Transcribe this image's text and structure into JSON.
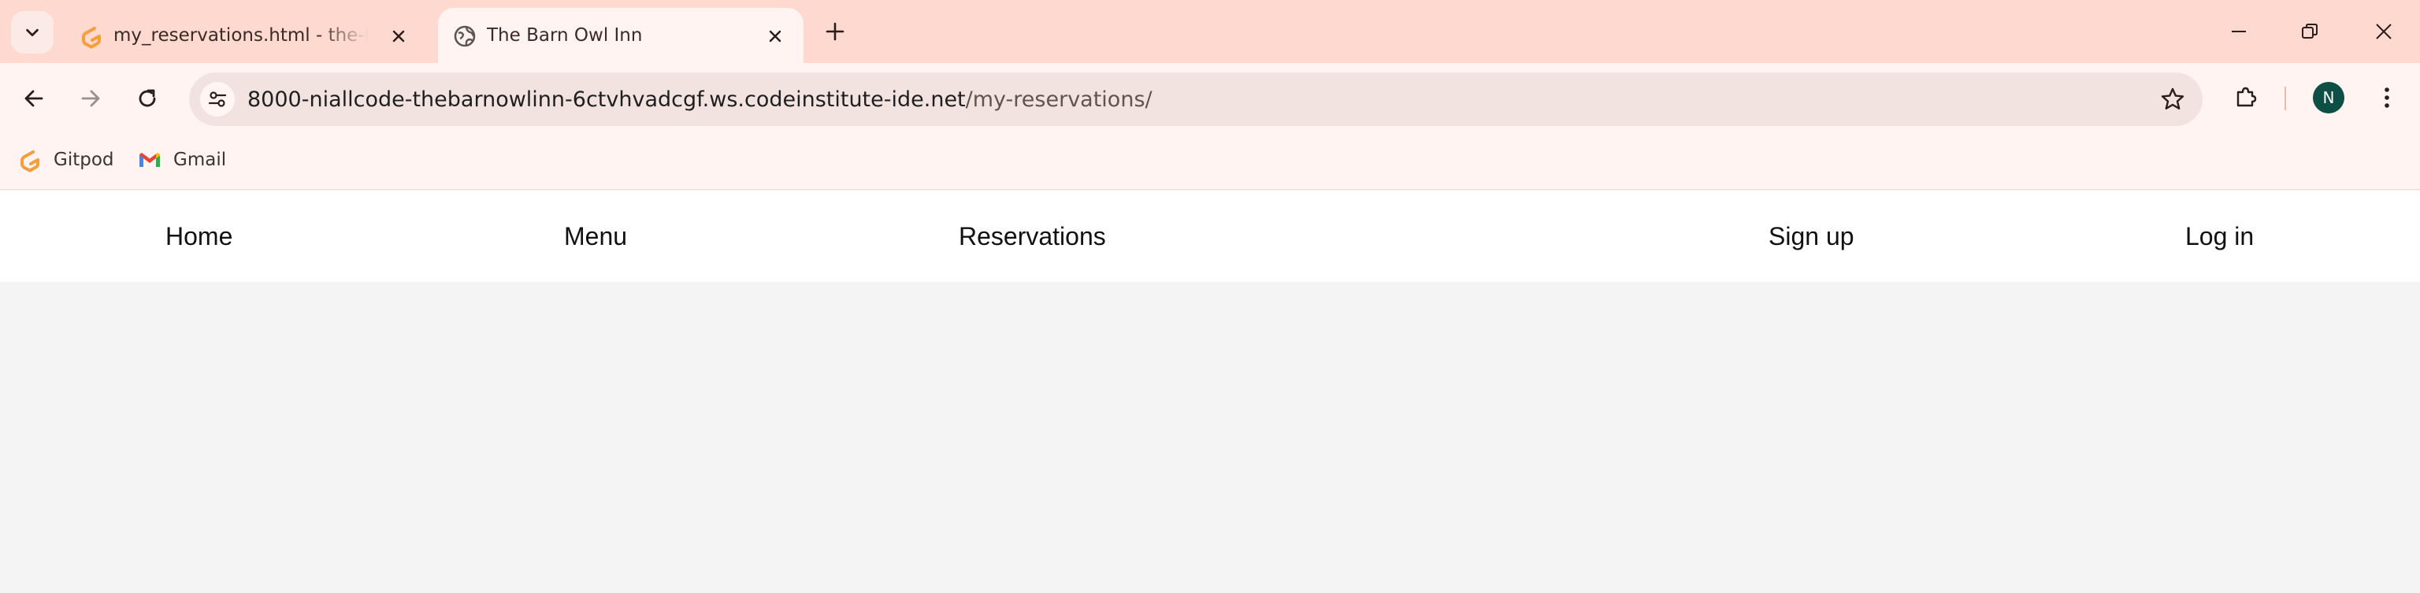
{
  "browser": {
    "tabs": [
      {
        "title": "my_reservations.html - the-barnowlinn - Gitpod",
        "icon": "gitpod-icon",
        "active": false
      },
      {
        "title": "The Barn Owl Inn",
        "icon": "globe-icon",
        "active": true
      }
    ],
    "address_bar": {
      "host": "8000-niallcode-thebarnowlinn-6ctvhvadcgf.ws.codeinstitute-ide.net",
      "path": "/my-reservations/"
    },
    "profile_initial": "N",
    "bookmarks": [
      {
        "label": "Gitpod",
        "icon": "gitpod-icon"
      },
      {
        "label": "Gmail",
        "icon": "gmail-icon"
      }
    ],
    "colors": {
      "tabstrip": "#fdd9cf",
      "toolbar": "#fff4f1",
      "omnibox": "#f2e3e0",
      "avatar": "#0d4f45",
      "gitpod_orange": "#f59e3a"
    }
  },
  "site_nav": {
    "home": "Home",
    "menu": "Menu",
    "reservations": "Reservations",
    "signup": "Sign up",
    "login": "Log in"
  },
  "page": {
    "background": "#f4f4f4",
    "navbar_background": "#ffffff"
  }
}
